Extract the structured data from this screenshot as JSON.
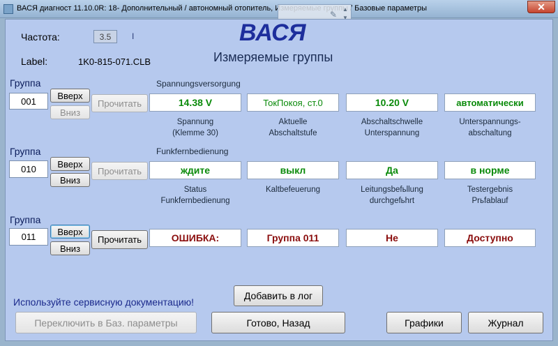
{
  "window": {
    "title": "ВАСЯ диагност 11.10.0R: 18- Дополнительный / автономный отопитель,  Измеряемые группы / Базовые параметры",
    "close_glyph": "✕"
  },
  "icons": {
    "app": "app-icon",
    "overlay": "wrench-icon",
    "close": "close-icon"
  },
  "header": {
    "freq_label": "Частота:",
    "freq_value": "3.5",
    "freq_marker": "I",
    "label_label": "Label:",
    "label_value": "1K0-815-071.CLB",
    "logo": "ВАСЯ",
    "subtitle": "Измеряемые группы"
  },
  "groups": [
    {
      "group_label": "Группа",
      "number": "001",
      "up": "Вверх",
      "down": "Вниз",
      "read": "Прочитать",
      "heading": "Spannungsversorgung",
      "values": [
        "14.38 V",
        "ТокПокоя, ст.0",
        "10.20 V",
        "автоматически"
      ],
      "captions": [
        [
          "Spannung",
          "(Klemme 30)"
        ],
        [
          "Aktuelle",
          "Abschaltstufe"
        ],
        [
          "Abschaltschwelle",
          "Unterspannung"
        ],
        [
          "Unterspannungs-",
          "abschaltung"
        ]
      ]
    },
    {
      "group_label": "Группа",
      "number": "010",
      "up": "Вверх",
      "down": "Вниз",
      "read": "Прочитать",
      "heading": "Funkfernbedienung",
      "values": [
        "ждите",
        "выкл",
        "Да",
        "в норме"
      ],
      "captions": [
        [
          "Status",
          "Funkfernbedienung"
        ],
        [
          "Kaltbefeuerung",
          ""
        ],
        [
          "Leitungsbefьllung",
          "durchgefьhrt"
        ],
        [
          "Testergebnis",
          "Prьfablauf"
        ]
      ]
    },
    {
      "group_label": "Группа",
      "number": "011",
      "up": "Вверх",
      "down": "Вниз",
      "read": "Прочитать",
      "heading": "",
      "values": [
        "ОШИБКА:",
        "Группа 011",
        "Не",
        "Доступно"
      ],
      "captions": []
    }
  ],
  "footer": {
    "doc_hint": "Используйте сервисную документацию!",
    "add_log": "Добавить в лог",
    "switch_basic": "Переключить в Баз. параметры",
    "done_back": "Готово, Назад",
    "graphs": "Графики",
    "journal": "Журнал"
  },
  "colors": {
    "logo": "#1d2e9c",
    "ok_value": "#0a8a0a",
    "error_value": "#8a0d0d",
    "hint": "#1b2a8c"
  }
}
